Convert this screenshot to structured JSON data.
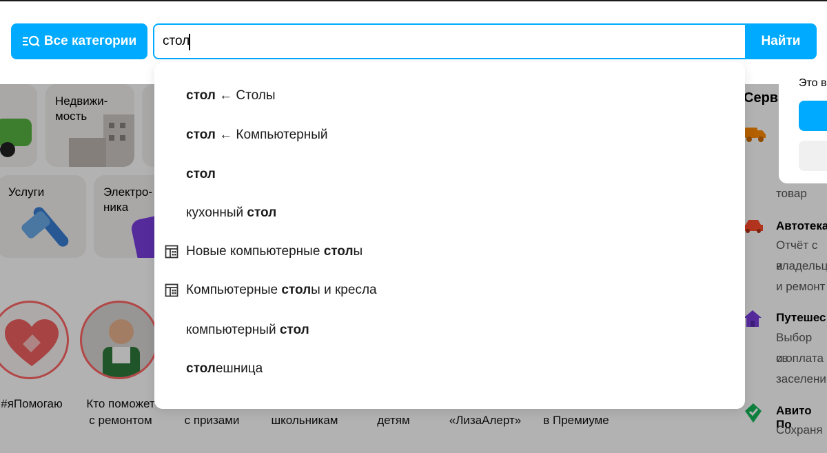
{
  "header": {
    "all_categories_label": "Все категории",
    "search_value": "стол",
    "find_label": "Найти"
  },
  "suggestions": [
    {
      "parts": [
        {
          "text": "стол",
          "bold": true
        },
        {
          "text": " ← Столы",
          "bold": false
        }
      ],
      "icon": ""
    },
    {
      "parts": [
        {
          "text": "стол",
          "bold": true
        },
        {
          "text": " ← Компьютерный",
          "bold": false
        }
      ],
      "icon": ""
    },
    {
      "parts": [
        {
          "text": "стол",
          "bold": true
        }
      ],
      "icon": ""
    },
    {
      "parts": [
        {
          "text": "кухонный ",
          "bold": false
        },
        {
          "text": "стол",
          "bold": true
        }
      ],
      "icon": ""
    },
    {
      "parts": [
        {
          "text": "Новые компьютерные ",
          "bold": false
        },
        {
          "text": "стол",
          "bold": true
        },
        {
          "text": "ы",
          "bold": false
        }
      ],
      "icon": "catalog-icon"
    },
    {
      "parts": [
        {
          "text": "Компьютерные ",
          "bold": false
        },
        {
          "text": "стол",
          "bold": true
        },
        {
          "text": "ы и кресла",
          "bold": false
        }
      ],
      "icon": "catalog-icon"
    },
    {
      "parts": [
        {
          "text": "компьютерный ",
          "bold": false
        },
        {
          "text": "стол",
          "bold": true
        }
      ],
      "icon": ""
    },
    {
      "parts": [
        {
          "text": "стол",
          "bold": true
        },
        {
          "text": "ешница",
          "bold": false
        }
      ],
      "icon": ""
    }
  ],
  "categories": {
    "realty": "Недвижи-\nмость",
    "services": "Услуги",
    "electronics": "Электро-\nника"
  },
  "stories": {
    "help": "#яПомогаю",
    "repair": "Кто поможет\nс ремонтом",
    "prizes": "с призами",
    "school": "школьникам",
    "kids": "детям",
    "liza": "«ЛизаАлерт»",
    "premium": "в Премиуме"
  },
  "services": {
    "title": "Серви",
    "item1_desc": "товар",
    "item2_name": "Автотека",
    "item2_desc1": "Отчёт с и",
    "item2_desc2": "владельц",
    "item2_desc3": "и ремонт",
    "item3_name": "Путешес",
    "item3_desc1": "Выбор св",
    "item3_desc2": "и оплата",
    "item3_desc3": "заселени",
    "item4_name": "Авито По",
    "item4_desc1": "Сохраня"
  },
  "popup": {
    "text": "Это в"
  },
  "colors": {
    "accent": "#00aaff",
    "story_ring": "#ff6666"
  }
}
